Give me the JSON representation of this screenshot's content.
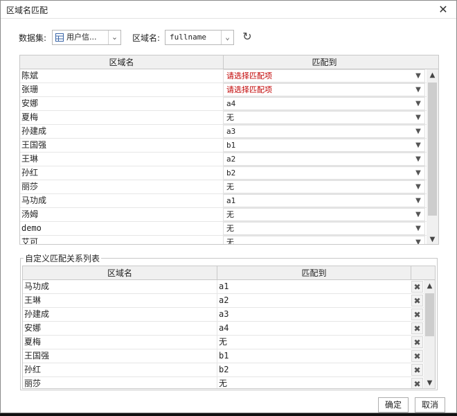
{
  "window": {
    "title": "区域名匹配",
    "close_glyph": "✕"
  },
  "toolbar": {
    "dataset_label": "数据集:",
    "dataset_value": "用户信...",
    "dataset_icon": "table-icon",
    "area_label": "区域名:",
    "area_value": "fullname",
    "refresh_icon": "refresh-icon"
  },
  "mapping_table": {
    "headers": [
      "区域名",
      "匹配到"
    ],
    "rows": [
      {
        "name": "陈斌",
        "match": "请选择匹配项",
        "placeholder": true
      },
      {
        "name": "张珊",
        "match": "请选择匹配项",
        "placeholder": true
      },
      {
        "name": "安娜",
        "match": "a4",
        "placeholder": false
      },
      {
        "name": "夏梅",
        "match": "无",
        "placeholder": false
      },
      {
        "name": "孙建成",
        "match": "a3",
        "placeholder": false
      },
      {
        "name": "王国强",
        "match": "b1",
        "placeholder": false
      },
      {
        "name": "王琳",
        "match": "a2",
        "placeholder": false
      },
      {
        "name": "孙红",
        "match": "b2",
        "placeholder": false
      },
      {
        "name": "丽莎",
        "match": "无",
        "placeholder": false
      },
      {
        "name": "马功成",
        "match": "a1",
        "placeholder": false
      },
      {
        "name": "汤姆",
        "match": "无",
        "placeholder": false
      },
      {
        "name": "demo",
        "match": "无",
        "placeholder": false
      },
      {
        "name": "艾可",
        "match": "无",
        "placeholder": false
      }
    ]
  },
  "custom_list": {
    "title": "自定义匹配关系列表",
    "headers": [
      "区域名",
      "匹配到"
    ],
    "rows": [
      {
        "name": "马功成",
        "match": "a1"
      },
      {
        "name": "王琳",
        "match": "a2"
      },
      {
        "name": "孙建成",
        "match": "a3"
      },
      {
        "name": "安娜",
        "match": "a4"
      },
      {
        "name": "夏梅",
        "match": "无"
      },
      {
        "name": "王国强",
        "match": "b1"
      },
      {
        "name": "孙红",
        "match": "b2"
      },
      {
        "name": "丽莎",
        "match": "无"
      }
    ],
    "delete_glyph": "✖"
  },
  "buttons": {
    "ok": "确定",
    "cancel": "取消"
  },
  "colors": {
    "placeholder_red": "#c00000"
  }
}
